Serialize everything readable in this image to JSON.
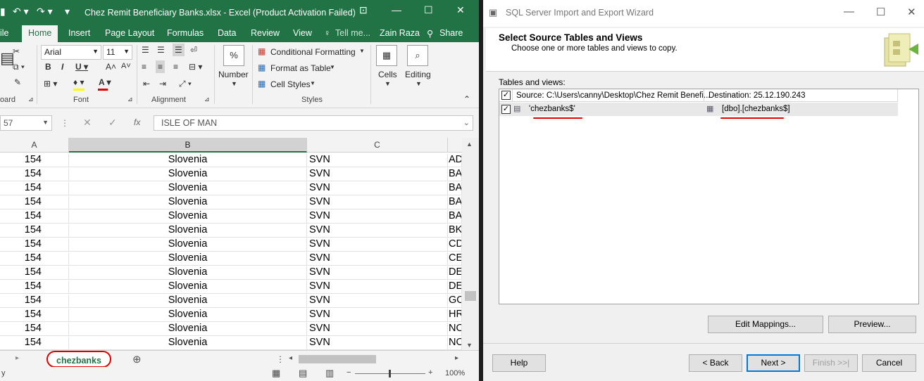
{
  "excel": {
    "window_title": "Chez Remit Beneficiary Banks.xlsx - Excel (Product Activation Failed)",
    "tabs": [
      "ile",
      "Home",
      "Insert",
      "Page Layout",
      "Formulas",
      "Data",
      "Review",
      "View"
    ],
    "tell_me": "Tell me...",
    "user": "Zain Raza",
    "share": "Share",
    "font_name": "Arial",
    "font_size": "11",
    "buttons": {
      "number": "Number",
      "cells": "Cells",
      "editing": "Editing",
      "conditional_formatting": "Conditional Formatting",
      "format_as_table": "Format as Table",
      "cell_styles": "Cell Styles",
      "percent": "%"
    },
    "group_labels": {
      "clipboard": "oard",
      "font": "Font",
      "alignment": "Alignment",
      "styles": "Styles"
    },
    "name_box": "57",
    "fx": "fx",
    "formula_value": "ISLE OF MAN",
    "columns": [
      "A",
      "B",
      "C"
    ],
    "rows": [
      [
        "154",
        "Slovenia",
        "SVN",
        "AD"
      ],
      [
        "154",
        "Slovenia",
        "SVN",
        "BA"
      ],
      [
        "154",
        "Slovenia",
        "SVN",
        "BA"
      ],
      [
        "154",
        "Slovenia",
        "SVN",
        "BA"
      ],
      [
        "154",
        "Slovenia",
        "SVN",
        "BA"
      ],
      [
        "154",
        "Slovenia",
        "SVN",
        "BK"
      ],
      [
        "154",
        "Slovenia",
        "SVN",
        "CD"
      ],
      [
        "154",
        "Slovenia",
        "SVN",
        "CE"
      ],
      [
        "154",
        "Slovenia",
        "SVN",
        "DE"
      ],
      [
        "154",
        "Slovenia",
        "SVN",
        "DE"
      ],
      [
        "154",
        "Slovenia",
        "SVN",
        "GO"
      ],
      [
        "154",
        "Slovenia",
        "SVN",
        "HR"
      ],
      [
        "154",
        "Slovenia",
        "SVN",
        "NO"
      ],
      [
        "154",
        "Slovenia",
        "SVN",
        "NO"
      ]
    ],
    "sheet_tab": "chezbanks",
    "status_left": "y",
    "zoom": "100%"
  },
  "wizard": {
    "window_title": "SQL Server Import and Export Wizard",
    "heading": "Select Source Tables and Views",
    "subheading": "Choose one or more tables and views to copy.",
    "list_label": "Tables and views:",
    "col_source": "Source: C:\\Users\\canny\\Desktop\\Chez Remit Benefi...",
    "col_destination": "Destination: 25.12.190.243",
    "row_source": "'chezbanks$'",
    "row_destination": "[dbo].[chezbanks$]",
    "btn_edit_mappings": "Edit Mappings...",
    "btn_preview": "Preview...",
    "btn_help": "Help",
    "btn_back": "< Back",
    "btn_next": "Next >",
    "btn_finish": "Finish >>|",
    "btn_cancel": "Cancel"
  },
  "colors": {
    "excel_green": "#217346",
    "annotation_red": "#e00000",
    "wizard_focus": "#0078d7"
  }
}
